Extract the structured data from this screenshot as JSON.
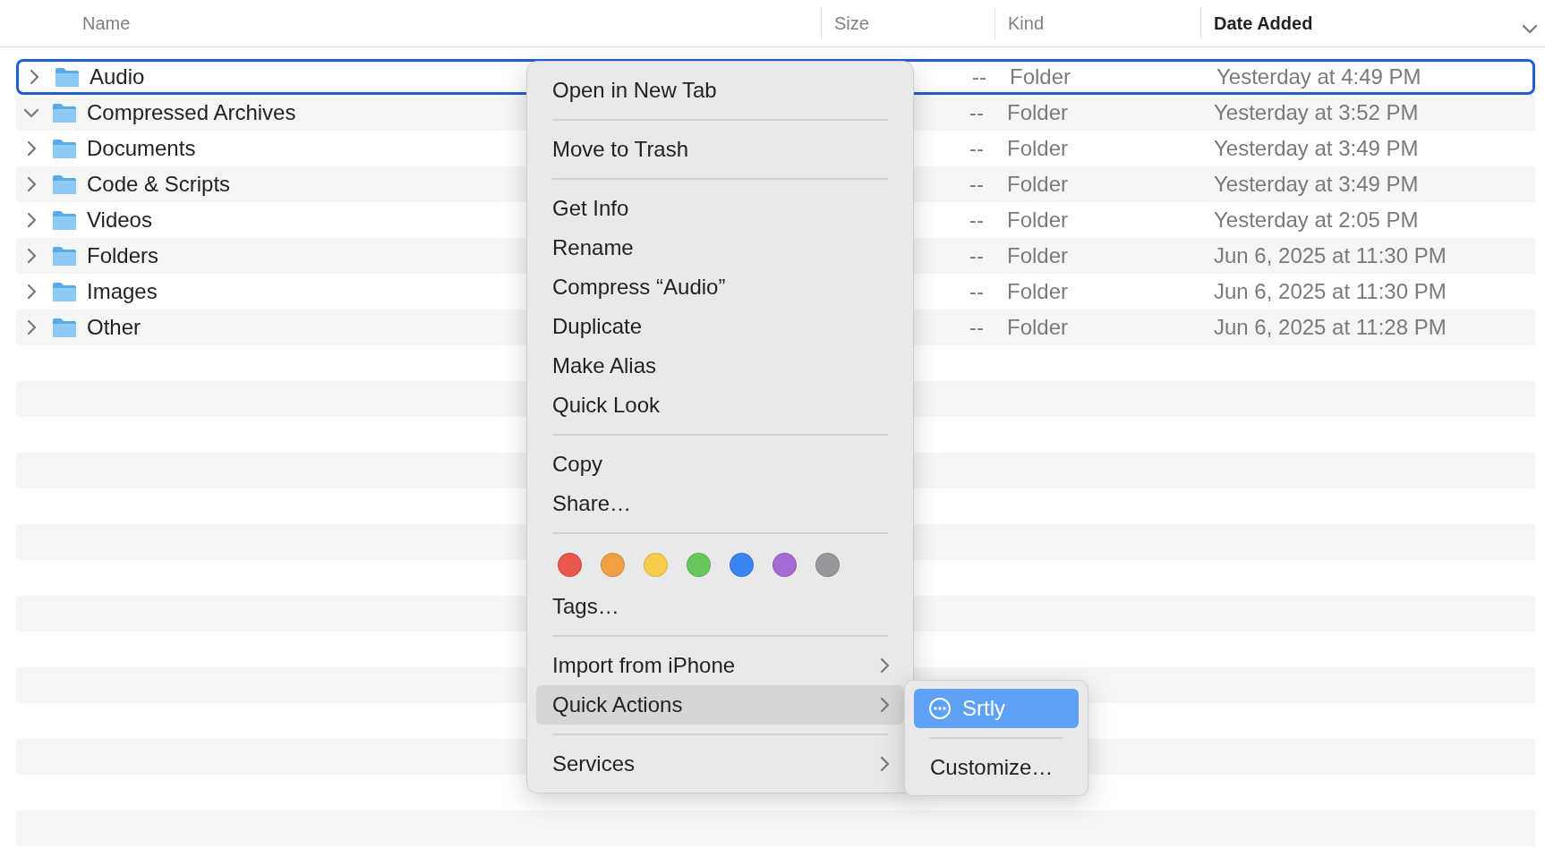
{
  "columns": [
    {
      "label": "Name",
      "sorted": false
    },
    {
      "label": "Size",
      "sorted": false
    },
    {
      "label": "Kind",
      "sorted": false
    },
    {
      "label": "Date Added",
      "sorted": true
    }
  ],
  "rows": [
    {
      "name": "Audio",
      "expanded": false,
      "selected": true,
      "size": "--",
      "kind": "Folder",
      "date_added": "Yesterday at 4:49 PM"
    },
    {
      "name": "Compressed Archives",
      "expanded": true,
      "selected": false,
      "size": "--",
      "kind": "Folder",
      "date_added": "Yesterday at 3:52 PM"
    },
    {
      "name": "Documents",
      "expanded": false,
      "selected": false,
      "size": "--",
      "kind": "Folder",
      "date_added": "Yesterday at 3:49 PM"
    },
    {
      "name": "Code & Scripts",
      "expanded": false,
      "selected": false,
      "size": "--",
      "kind": "Folder",
      "date_added": "Yesterday at 3:49 PM"
    },
    {
      "name": "Videos",
      "expanded": false,
      "selected": false,
      "size": "--",
      "kind": "Folder",
      "date_added": "Yesterday at 2:05 PM"
    },
    {
      "name": "Folders",
      "expanded": false,
      "selected": false,
      "size": "--",
      "kind": "Folder",
      "date_added": "Jun 6, 2025 at 11:30 PM"
    },
    {
      "name": "Images",
      "expanded": false,
      "selected": false,
      "size": "--",
      "kind": "Folder",
      "date_added": "Jun 6, 2025 at 11:30 PM"
    },
    {
      "name": "Other",
      "expanded": false,
      "selected": false,
      "size": "--",
      "kind": "Folder",
      "date_added": "Jun 6, 2025 at 11:28 PM"
    }
  ],
  "context_menu": {
    "items": [
      {
        "kind": "item",
        "label": "Open in New Tab",
        "selected": false
      },
      {
        "kind": "separator"
      },
      {
        "kind": "item",
        "label": "Move to Trash",
        "selected": false
      },
      {
        "kind": "separator"
      },
      {
        "kind": "item",
        "label": "Get Info",
        "selected": false
      },
      {
        "kind": "item",
        "label": "Rename",
        "selected": false
      },
      {
        "kind": "item",
        "label": "Compress “Audio”",
        "selected": false
      },
      {
        "kind": "item",
        "label": "Duplicate",
        "selected": false
      },
      {
        "kind": "item",
        "label": "Make Alias",
        "selected": false
      },
      {
        "kind": "item",
        "label": "Quick Look",
        "selected": false
      },
      {
        "kind": "separator"
      },
      {
        "kind": "item",
        "label": "Copy",
        "selected": false
      },
      {
        "kind": "item",
        "label": "Share…",
        "selected": false
      },
      {
        "kind": "separator"
      },
      {
        "kind": "tags",
        "tags": [
          {
            "color": "#e9574f"
          },
          {
            "color": "#f0a043"
          },
          {
            "color": "#f5cd4a"
          },
          {
            "color": "#67c75e"
          },
          {
            "color": "#3b85f0"
          },
          {
            "color": "#a76ad3"
          },
          {
            "color": "#98989c"
          }
        ]
      },
      {
        "kind": "item",
        "label": "Tags…",
        "selected": false
      },
      {
        "kind": "separator"
      },
      {
        "kind": "submenu",
        "label": "Import from iPhone",
        "selected": false
      },
      {
        "kind": "submenu",
        "label": "Quick Actions",
        "selected": true
      },
      {
        "kind": "separator"
      },
      {
        "kind": "submenu",
        "label": "Services",
        "selected": false
      }
    ],
    "submenu": {
      "items": [
        {
          "kind": "action",
          "label": "Srtly",
          "selected": true
        },
        {
          "kind": "separator"
        },
        {
          "kind": "item",
          "label": "Customize…",
          "selected": false
        }
      ]
    }
  }
}
